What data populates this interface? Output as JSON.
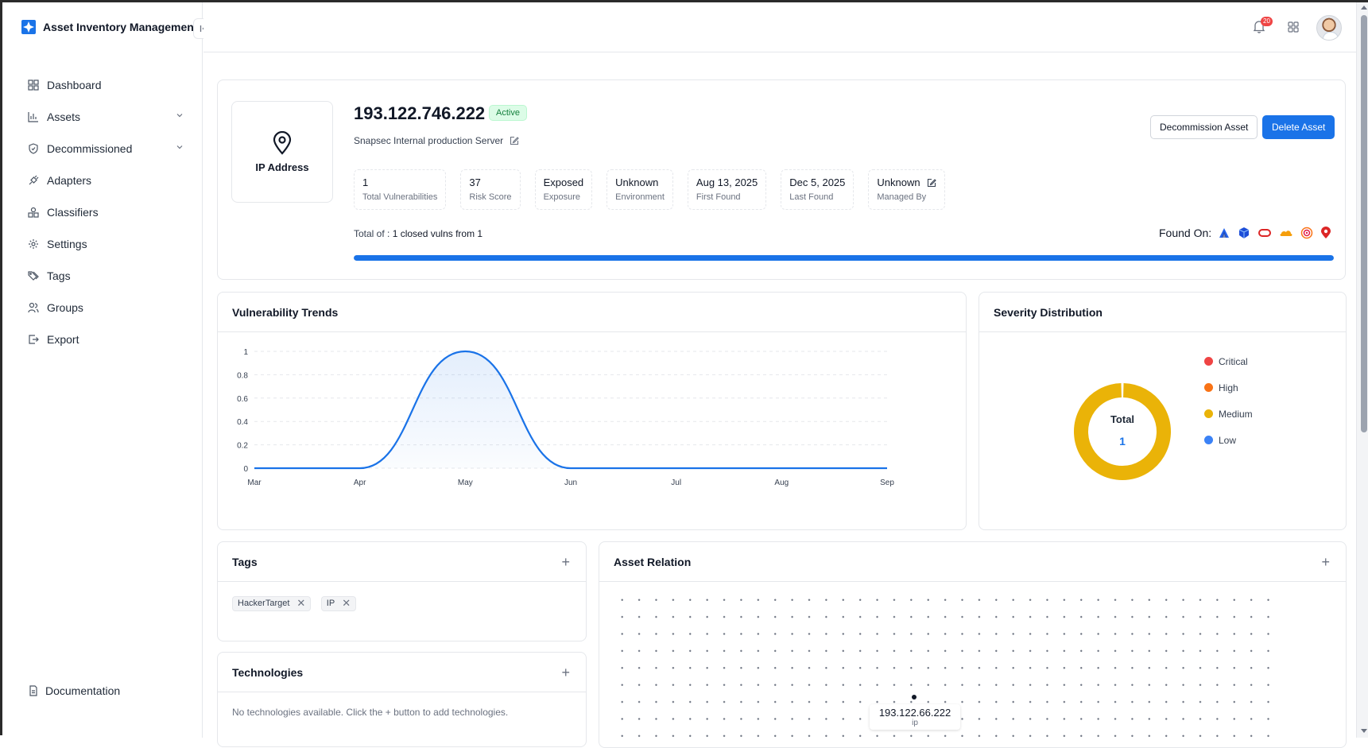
{
  "app": {
    "title": "Asset Inventory Management"
  },
  "sidebar": {
    "items": [
      {
        "label": "Dashboard",
        "icon": "grid-icon",
        "has_chevron": false
      },
      {
        "label": "Assets",
        "icon": "bar-chart-icon",
        "has_chevron": true
      },
      {
        "label": "Decommissioned",
        "icon": "shield-icon",
        "has_chevron": true
      },
      {
        "label": "Adapters",
        "icon": "plug-icon",
        "has_chevron": false
      },
      {
        "label": "Classifiers",
        "icon": "shapes-icon",
        "has_chevron": false
      },
      {
        "label": "Settings",
        "icon": "gear-icon",
        "has_chevron": false
      },
      {
        "label": "Tags",
        "icon": "tags-icon",
        "has_chevron": false
      },
      {
        "label": "Groups",
        "icon": "users-icon",
        "has_chevron": false
      },
      {
        "label": "Export",
        "icon": "export-icon",
        "has_chevron": false
      }
    ],
    "documentation": "Documentation"
  },
  "topbar": {
    "notification_count": "20"
  },
  "asset": {
    "type_label": "IP Address",
    "ip": "193.122.746.222",
    "status": "Active",
    "description": "Snapsec Internal production Server",
    "decommission_label": "Decommission Asset",
    "delete_label": "Delete Asset",
    "stats": [
      {
        "value": "1",
        "label": "Total Vulnerabilities"
      },
      {
        "value": "37",
        "label": "Risk Score"
      },
      {
        "value": "Exposed",
        "label": "Exposure"
      },
      {
        "value": "Unknown",
        "label": "Environment"
      },
      {
        "value": "Aug 13, 2025",
        "label": "First Found"
      },
      {
        "value": "Dec 5, 2025",
        "label": "Last Found"
      },
      {
        "value": "Unknown",
        "label": "Managed By"
      }
    ],
    "closed_prefix": "Total of :",
    "closed_text": "1 closed vulns from 1",
    "closed_fraction": 1.0,
    "found_on_label": "Found On:",
    "found_on_icons": [
      "atlassian-icon",
      "cube-icon",
      "oracle-icon",
      "cloudflare-icon",
      "target-icon",
      "map-pin-icon"
    ]
  },
  "trends": {
    "title": "Vulnerability Trends",
    "chart_data": {
      "type": "area",
      "categories": [
        "Mar",
        "Apr",
        "May",
        "Jun",
        "Jul",
        "Aug",
        "Sep"
      ],
      "values": [
        0,
        0,
        1,
        0,
        0,
        0,
        0
      ],
      "yticks": [
        "0",
        "0.2",
        "0.4",
        "0.6",
        "0.8",
        "1"
      ],
      "ylim": [
        0,
        1
      ],
      "grid": true,
      "color": "#1a73e8"
    }
  },
  "severity": {
    "title": "Severity Distribution",
    "center_label": "Total",
    "total": "1",
    "chart_data": {
      "type": "pie",
      "categories": [
        "Critical",
        "High",
        "Medium",
        "Low"
      ],
      "values": [
        0,
        0,
        1,
        0
      ],
      "colors": [
        "#ef4444",
        "#f97316",
        "#eab308",
        "#3b82f6"
      ]
    }
  },
  "tags": {
    "title": "Tags",
    "items": [
      "HackerTarget",
      "IP"
    ]
  },
  "technologies": {
    "title": "Technologies",
    "empty": "No technologies available. Click the + button to add technologies."
  },
  "relation": {
    "title": "Asset Relation",
    "node_label": "193.122.66.222",
    "node_sub": "ip"
  }
}
